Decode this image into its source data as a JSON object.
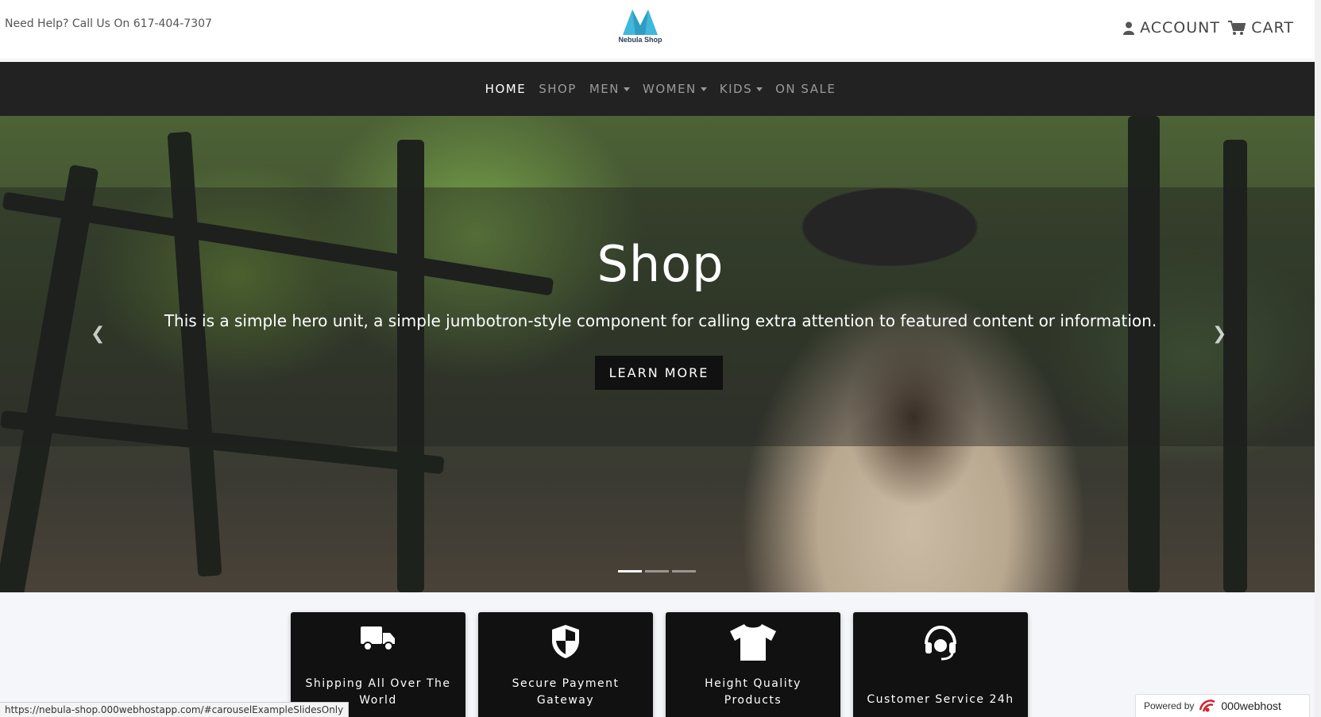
{
  "topbar": {
    "help_text": "Need Help? Call Us On 617-404-7307",
    "logo_text": "Nebula Shop",
    "account_label": "ACCOUNT",
    "cart_label": "CART"
  },
  "nav": {
    "items": [
      {
        "label": "HOME",
        "active": true
      },
      {
        "label": "SHOP"
      },
      {
        "label": "MEN"
      },
      {
        "label": "WOMEN"
      },
      {
        "label": "KIDS"
      },
      {
        "label": "ON SALE"
      }
    ]
  },
  "hero": {
    "title": "Shop",
    "text": "This is a simple hero unit, a simple jumbotron-style component for calling extra attention to featured content or information.",
    "button_label": "LEARN MORE",
    "prev_icon": "chevron-left-icon",
    "next_icon": "chevron-right-icon",
    "slides": 3,
    "active_slide": 1
  },
  "features": [
    {
      "icon": "truck-icon",
      "label": "Shipping All Over The World"
    },
    {
      "icon": "shield-icon",
      "label": "Secure Payment Gateway"
    },
    {
      "icon": "tshirt-icon",
      "label": "Height Quality Products"
    },
    {
      "icon": "headset-icon",
      "label": "Customer Service 24h"
    }
  ],
  "status_bar": {
    "url": "https://nebula-shop.000webhostapp.com/#carouselExampleSlidesOnly"
  },
  "powered": {
    "prefix": "Powered by",
    "brand": "000webhost"
  },
  "colors": {
    "logo_accent": "#3fb8dc",
    "nav_bg": "#222222",
    "card_bg": "#111111"
  }
}
